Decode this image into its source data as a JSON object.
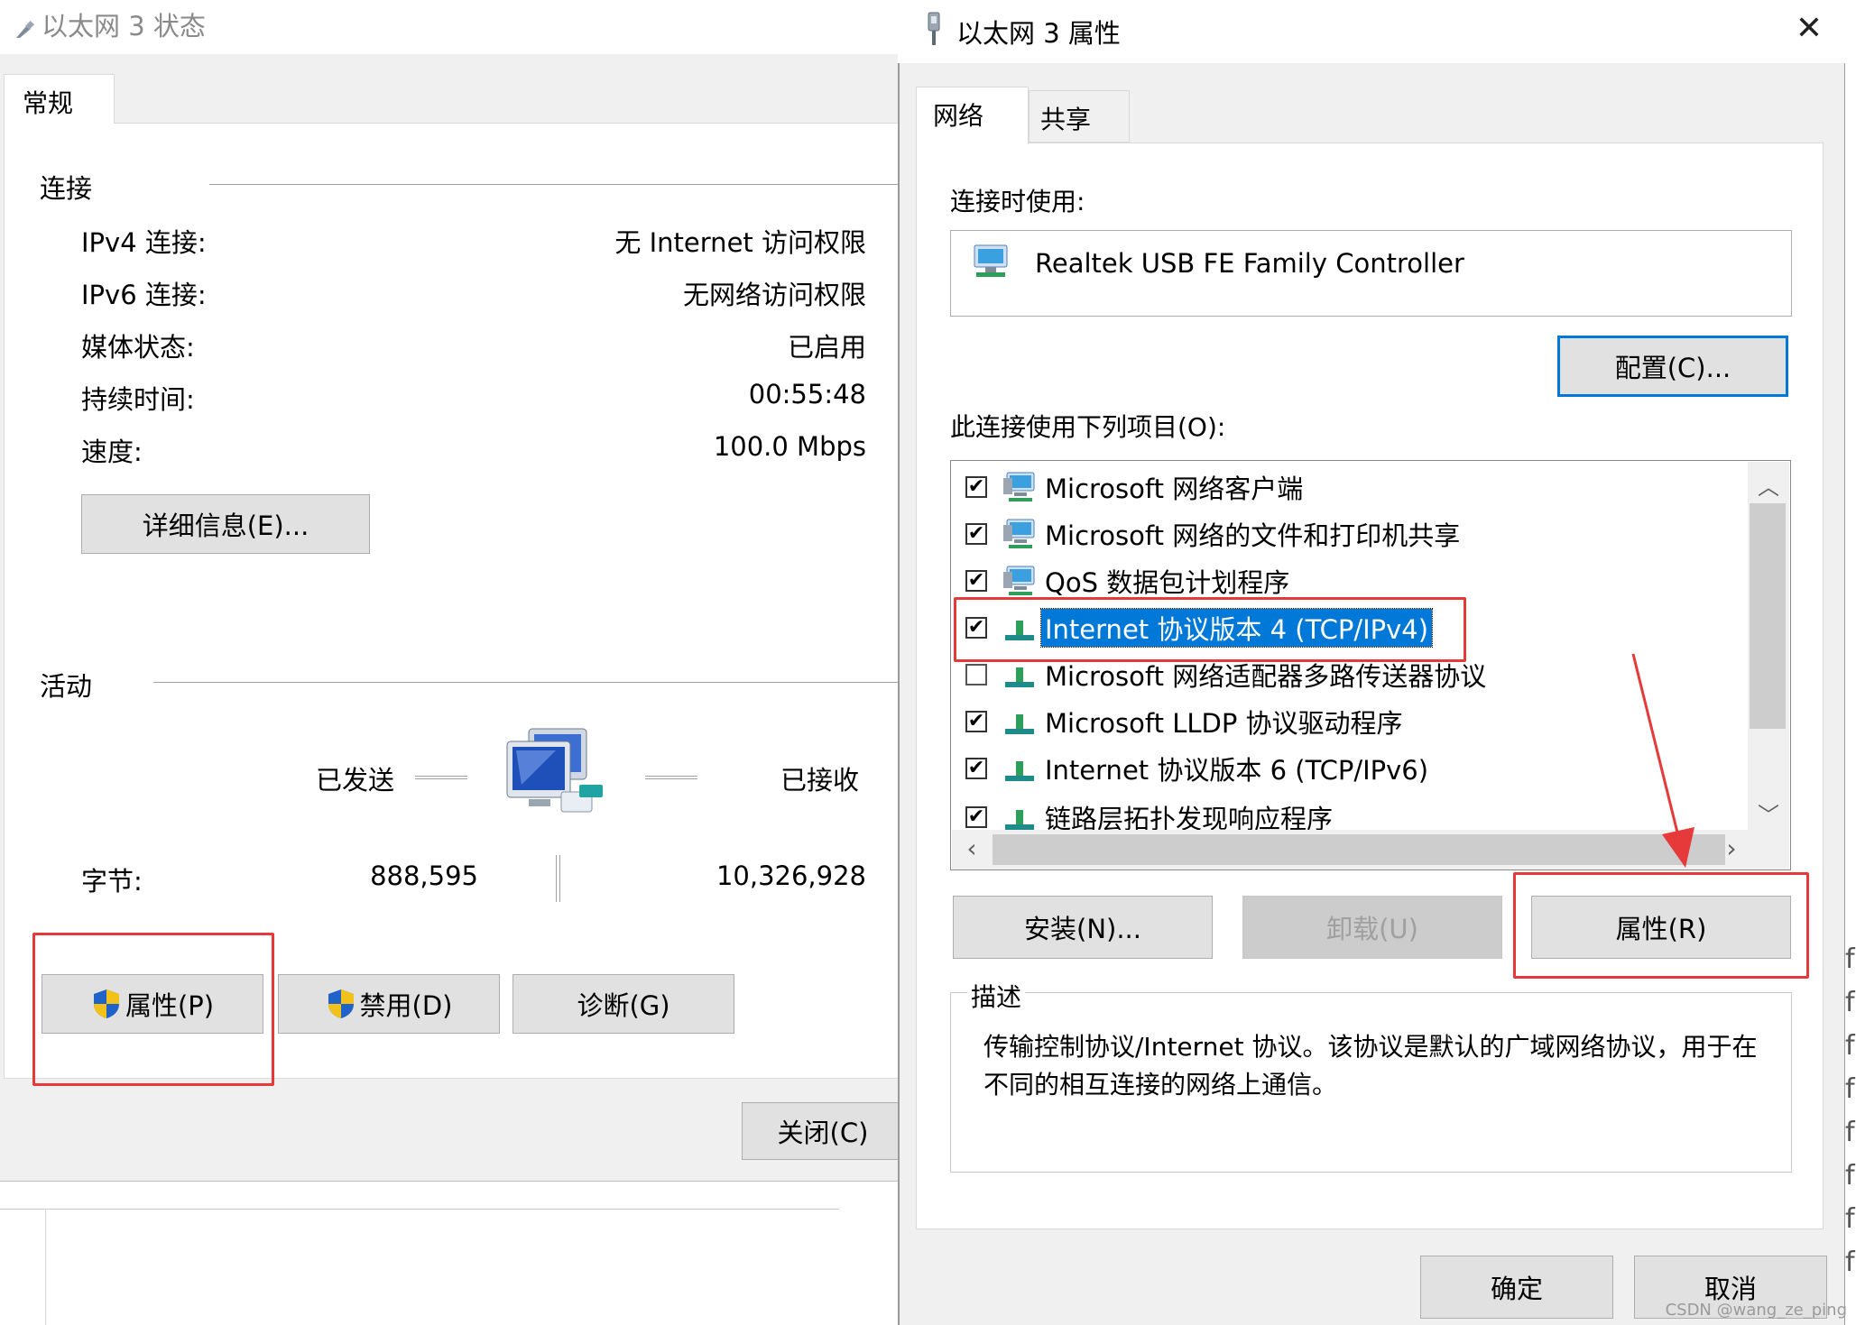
{
  "status_window": {
    "title": "以太网 3 状态",
    "tab": "常规",
    "connection_group": "连接",
    "rows": [
      {
        "label": "IPv4 连接:",
        "value": "无 Internet 访问权限"
      },
      {
        "label": "IPv6 连接:",
        "value": "无网络访问权限"
      },
      {
        "label": "媒体状态:",
        "value": "已启用"
      },
      {
        "label": "持续时间:",
        "value": "00:55:48"
      },
      {
        "label": "速度:",
        "value": "100.0 Mbps"
      }
    ],
    "details_button": "详细信息(E)...",
    "activity_group": "活动",
    "sent_label": "已发送",
    "received_label": "已接收",
    "bytes_label": "字节:",
    "bytes_sent": "888,595",
    "bytes_received": "10,326,928",
    "properties_button": "属性(P)",
    "disable_button": "禁用(D)",
    "diagnose_button": "诊断(G)",
    "close_button": "关闭(C)"
  },
  "properties_window": {
    "title": "以太网 3 属性",
    "tabs": [
      "网络",
      "共享"
    ],
    "connect_using_label": "连接时使用:",
    "adapter_name": "Realtek USB FE Family Controller",
    "configure_button": "配置(C)...",
    "items_label": "此连接使用下列项目(O):",
    "items": [
      {
        "label": "Microsoft 网络客户端",
        "checked": true,
        "icon": "network-client-icon"
      },
      {
        "label": "Microsoft 网络的文件和打印机共享",
        "checked": true,
        "icon": "network-service-icon"
      },
      {
        "label": "QoS 数据包计划程序",
        "checked": true,
        "icon": "network-service-icon"
      },
      {
        "label": "Internet 协议版本 4 (TCP/IPv4)",
        "checked": true,
        "icon": "protocol-icon",
        "selected": true
      },
      {
        "label": "Microsoft 网络适配器多路传送器协议",
        "checked": false,
        "icon": "protocol-icon"
      },
      {
        "label": "Microsoft LLDP 协议驱动程序",
        "checked": true,
        "icon": "protocol-icon"
      },
      {
        "label": "Internet 协议版本 6 (TCP/IPv6)",
        "checked": true,
        "icon": "protocol-icon"
      },
      {
        "label": "链路层拓扑发现响应程序",
        "checked": true,
        "icon": "protocol-icon"
      }
    ],
    "install_button": "安装(N)...",
    "uninstall_button": "卸载(U)",
    "properties_button": "属性(R)",
    "description_label": "描述",
    "description_text": "传输控制协议/Internet 协议。该协议是默认的广域网络协议，用于在不同的相互连接的网络上通信。",
    "ok_button": "确定",
    "cancel_button": "取消",
    "close_glyph": "✕",
    "check_glyph": "✔"
  },
  "colors": {
    "highlight": "#e5393a",
    "selection": "#0078d7"
  },
  "watermark": "CSDN @wang_ze_ping"
}
